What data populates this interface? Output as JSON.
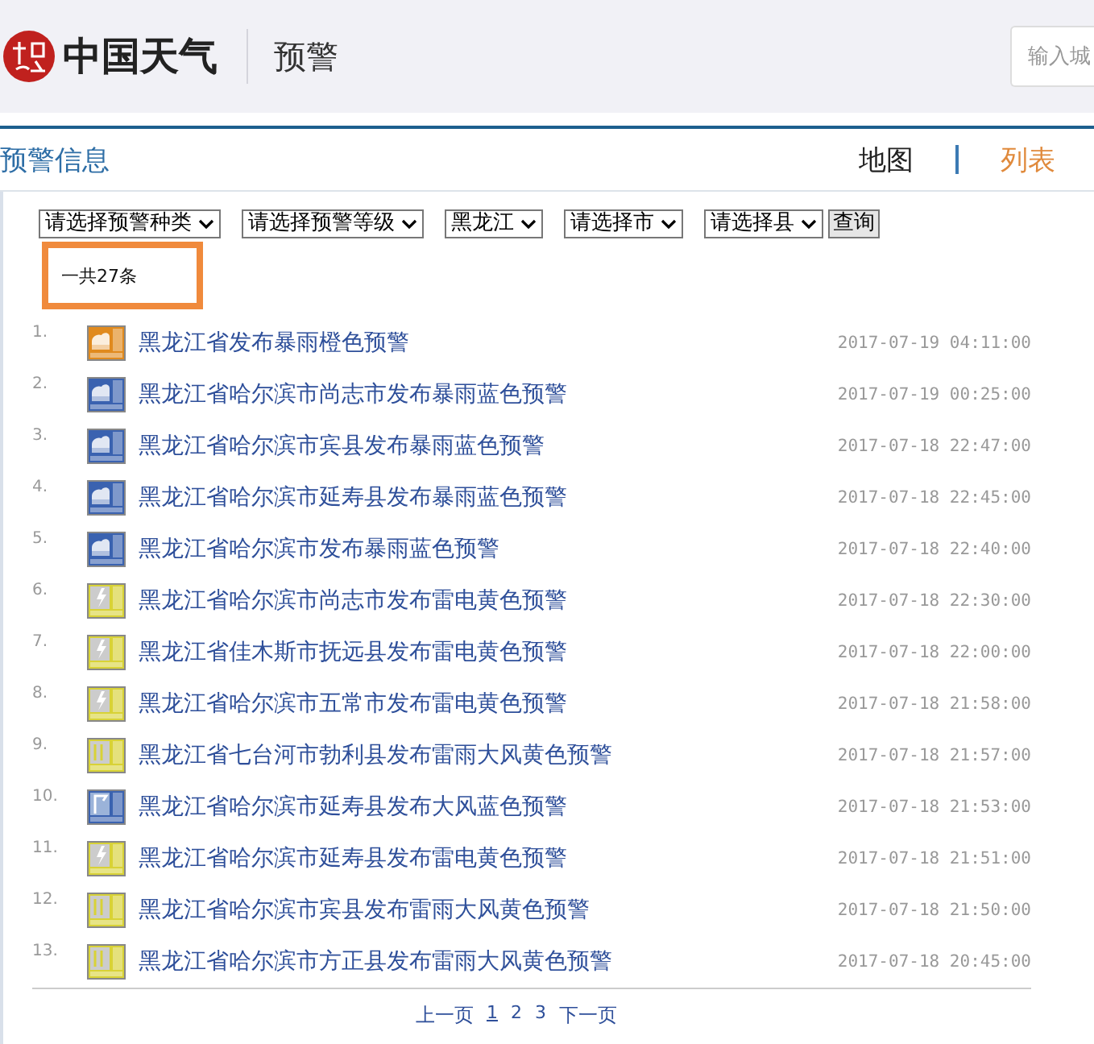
{
  "header": {
    "site_name": "中国天气",
    "section": "预警",
    "search": {
      "placeholder": "输入城"
    }
  },
  "page_title": "预警信息",
  "view_tabs": [
    {
      "label": "地图",
      "selected": false
    },
    {
      "label": "列表",
      "selected": true
    }
  ],
  "filters": [
    {
      "value": "请选择预警种类"
    },
    {
      "value": "请选择预警等级"
    },
    {
      "value": "黑龙江"
    },
    {
      "value": "请选择市"
    },
    {
      "value": "请选择县"
    }
  ],
  "query_button": "查询",
  "count": "一共27条",
  "alerts": [
    {
      "number": "1.",
      "kind": "rainstorm",
      "color": "#e08a1e",
      "title": "黑龙江省发布暴雨橙色预警",
      "time": "2017-07-19 04:11:00"
    },
    {
      "number": "2.",
      "kind": "rainstorm",
      "color": "#3a62b0",
      "title": "黑龙江省哈尔滨市尚志市发布暴雨蓝色预警",
      "time": "2017-07-19 00:25:00"
    },
    {
      "number": "3.",
      "kind": "rainstorm",
      "color": "#3a62b0",
      "title": "黑龙江省哈尔滨市宾县发布暴雨蓝色预警",
      "time": "2017-07-18 22:47:00"
    },
    {
      "number": "4.",
      "kind": "rainstorm",
      "color": "#3a62b0",
      "title": "黑龙江省哈尔滨市延寿县发布暴雨蓝色预警",
      "time": "2017-07-18 22:45:00"
    },
    {
      "number": "5.",
      "kind": "rainstorm",
      "color": "#3a62b0",
      "title": "黑龙江省哈尔滨市发布暴雨蓝色预警",
      "time": "2017-07-18 22:40:00"
    },
    {
      "number": "6.",
      "kind": "thunder",
      "color": "#d8d236",
      "title": "黑龙江省哈尔滨市尚志市发布雷电黄色预警",
      "time": "2017-07-18 22:30:00"
    },
    {
      "number": "7.",
      "kind": "thunder",
      "color": "#d8d236",
      "title": "黑龙江省佳木斯市抚远县发布雷电黄色预警",
      "time": "2017-07-18 22:00:00"
    },
    {
      "number": "8.",
      "kind": "thunder",
      "color": "#d8d236",
      "title": "黑龙江省哈尔滨市五常市发布雷电黄色预警",
      "time": "2017-07-18 21:58:00"
    },
    {
      "number": "9.",
      "kind": "storm",
      "color": "#d8d236",
      "title": "黑龙江省七台河市勃利县发布雷雨大风黄色预警",
      "time": "2017-07-18 21:57:00"
    },
    {
      "number": "10.",
      "kind": "gale",
      "color": "#3a62b0",
      "title": "黑龙江省哈尔滨市延寿县发布大风蓝色预警",
      "time": "2017-07-18 21:53:00"
    },
    {
      "number": "11.",
      "kind": "thunder",
      "color": "#d8d236",
      "title": "黑龙江省哈尔滨市延寿县发布雷电黄色预警",
      "time": "2017-07-18 21:51:00"
    },
    {
      "number": "12.",
      "kind": "storm",
      "color": "#d8d236",
      "title": "黑龙江省哈尔滨市宾县发布雷雨大风黄色预警",
      "time": "2017-07-18 21:50:00"
    },
    {
      "number": "13.",
      "kind": "storm",
      "color": "#d8d236",
      "title": "黑龙江省哈尔滨市方正县发布雷雨大风黄色预警",
      "time": "2017-07-18 20:45:00"
    }
  ],
  "pagination": {
    "previous": "上一页",
    "pages": [
      {
        "label": "1",
        "selected": true
      },
      {
        "label": "2",
        "selected": false
      },
      {
        "label": "3",
        "selected": false
      }
    ],
    "next": "下一页"
  }
}
